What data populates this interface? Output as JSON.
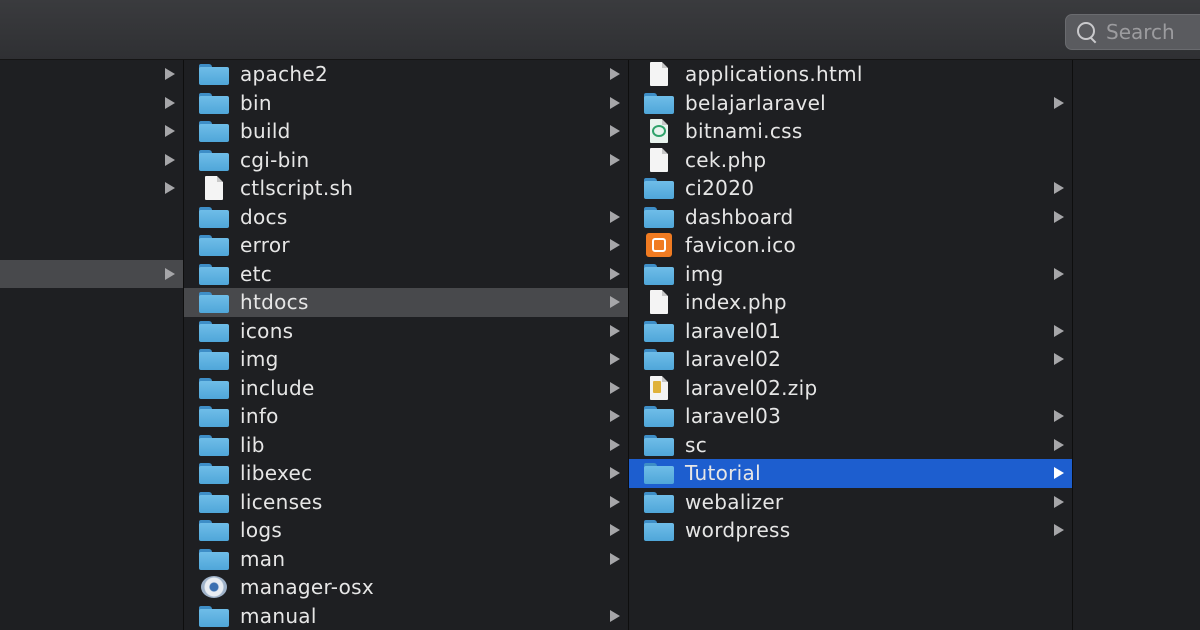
{
  "search": {
    "placeholder": "Search"
  },
  "column1": {
    "rows": [
      {
        "chevron": true,
        "selected": false
      },
      {
        "chevron": true,
        "selected": false
      },
      {
        "chevron": true,
        "selected": false
      },
      {
        "chevron": true,
        "selected": false
      },
      {
        "chevron": true,
        "selected": false
      },
      {
        "chevron": false,
        "selected": false
      },
      {
        "chevron": false,
        "selected": false
      },
      {
        "chevron": true,
        "selected": true
      }
    ]
  },
  "column2": {
    "items": [
      {
        "name": "apache2",
        "icon": "folder-icon",
        "chevron": true,
        "selected": false
      },
      {
        "name": "bin",
        "icon": "folder-icon",
        "chevron": true,
        "selected": false
      },
      {
        "name": "build",
        "icon": "folder-icon",
        "chevron": true,
        "selected": false
      },
      {
        "name": "cgi-bin",
        "icon": "folder-icon",
        "chevron": true,
        "selected": false
      },
      {
        "name": "ctlscript.sh",
        "icon": "document-icon",
        "chevron": false,
        "selected": false
      },
      {
        "name": "docs",
        "icon": "folder-icon",
        "chevron": true,
        "selected": false
      },
      {
        "name": "error",
        "icon": "folder-icon",
        "chevron": true,
        "selected": false
      },
      {
        "name": "etc",
        "icon": "folder-icon",
        "chevron": true,
        "selected": false
      },
      {
        "name": "htdocs",
        "icon": "folder-icon",
        "chevron": true,
        "selected": true
      },
      {
        "name": "icons",
        "icon": "folder-icon",
        "chevron": true,
        "selected": false
      },
      {
        "name": "img",
        "icon": "folder-icon",
        "chevron": true,
        "selected": false
      },
      {
        "name": "include",
        "icon": "folder-icon",
        "chevron": true,
        "selected": false
      },
      {
        "name": "info",
        "icon": "folder-icon",
        "chevron": true,
        "selected": false
      },
      {
        "name": "lib",
        "icon": "folder-icon",
        "chevron": true,
        "selected": false
      },
      {
        "name": "libexec",
        "icon": "folder-icon",
        "chevron": true,
        "selected": false
      },
      {
        "name": "licenses",
        "icon": "folder-icon",
        "chevron": true,
        "selected": false
      },
      {
        "name": "logs",
        "icon": "folder-icon",
        "chevron": true,
        "selected": false
      },
      {
        "name": "man",
        "icon": "folder-icon",
        "chevron": true,
        "selected": false
      },
      {
        "name": "manager-osx",
        "icon": "gear-app-icon",
        "chevron": false,
        "selected": false
      },
      {
        "name": "manual",
        "icon": "folder-icon",
        "chevron": true,
        "selected": false
      }
    ]
  },
  "column3": {
    "items": [
      {
        "name": "applications.html",
        "icon": "document-icon",
        "chevron": false,
        "selected": false
      },
      {
        "name": "belajarlaravel",
        "icon": "folder-icon",
        "chevron": true,
        "selected": false
      },
      {
        "name": "bitnami.css",
        "icon": "css-file-icon",
        "chevron": false,
        "selected": false
      },
      {
        "name": "cek.php",
        "icon": "document-icon",
        "chevron": false,
        "selected": false
      },
      {
        "name": "ci2020",
        "icon": "folder-icon",
        "chevron": true,
        "selected": false
      },
      {
        "name": "dashboard",
        "icon": "folder-icon",
        "chevron": true,
        "selected": false
      },
      {
        "name": "favicon.ico",
        "icon": "xampp-icon",
        "chevron": false,
        "selected": false
      },
      {
        "name": "img",
        "icon": "folder-icon",
        "chevron": true,
        "selected": false
      },
      {
        "name": "index.php",
        "icon": "document-icon",
        "chevron": false,
        "selected": false
      },
      {
        "name": "laravel01",
        "icon": "folder-icon",
        "chevron": true,
        "selected": false
      },
      {
        "name": "laravel02",
        "icon": "folder-icon",
        "chevron": true,
        "selected": false
      },
      {
        "name": "laravel02.zip",
        "icon": "zip-icon",
        "chevron": false,
        "selected": false
      },
      {
        "name": "laravel03",
        "icon": "folder-icon",
        "chevron": true,
        "selected": false
      },
      {
        "name": "sc",
        "icon": "folder-icon",
        "chevron": true,
        "selected": false
      },
      {
        "name": "Tutorial",
        "icon": "folder-icon",
        "chevron": true,
        "selected": true
      },
      {
        "name": "webalizer",
        "icon": "folder-icon",
        "chevron": true,
        "selected": false
      },
      {
        "name": "wordpress",
        "icon": "folder-icon",
        "chevron": true,
        "selected": false
      }
    ]
  },
  "colors": {
    "active_selection": "#1d5ecf",
    "inactive_selection": "#48494c",
    "folder": "#5aaee0"
  }
}
